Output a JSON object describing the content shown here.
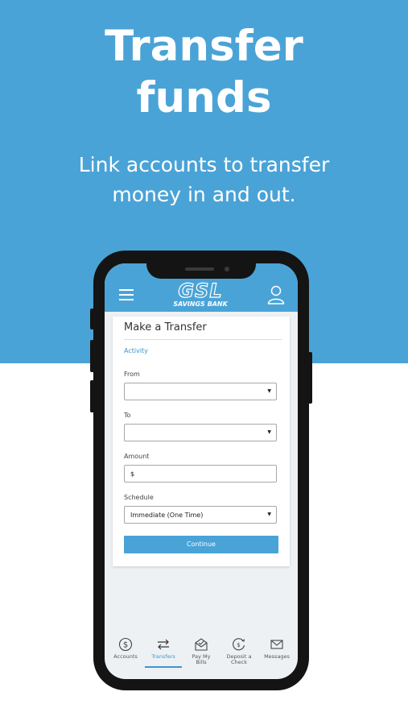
{
  "hero": {
    "headline_line1": "Transfer",
    "headline_line2": "funds",
    "subline_line1": "Link accounts to transfer",
    "subline_line2": "money in and out."
  },
  "colors": {
    "brand": "#4aa3d6",
    "link": "#3a96d0"
  },
  "app": {
    "logo_main": "GSL",
    "logo_sub": "SAVINGS BANK",
    "menu_icon": "hamburger-icon",
    "profile_icon": "user-icon"
  },
  "form": {
    "title": "Make a Transfer",
    "activity_link": "Activity",
    "from_label": "From",
    "from_value": "",
    "to_label": "To",
    "to_value": "",
    "amount_label": "Amount",
    "amount_prefix": "$",
    "schedule_label": "Schedule",
    "schedule_value": "Immediate (One Time)",
    "continue_label": "Continue"
  },
  "tabbar": {
    "items": [
      {
        "label": "Accounts",
        "icon": "dollar-circle-icon",
        "active": false
      },
      {
        "label": "Transfers",
        "icon": "transfer-arrows-icon",
        "active": true
      },
      {
        "label_line1": "Pay My",
        "label_line2": "Bills",
        "icon": "envelope-check-icon",
        "active": false
      },
      {
        "label_line1": "Deposit a",
        "label_line2": "Check",
        "icon": "deposit-check-icon",
        "active": false
      },
      {
        "label": "Messages",
        "icon": "mail-icon",
        "active": false
      }
    ]
  }
}
